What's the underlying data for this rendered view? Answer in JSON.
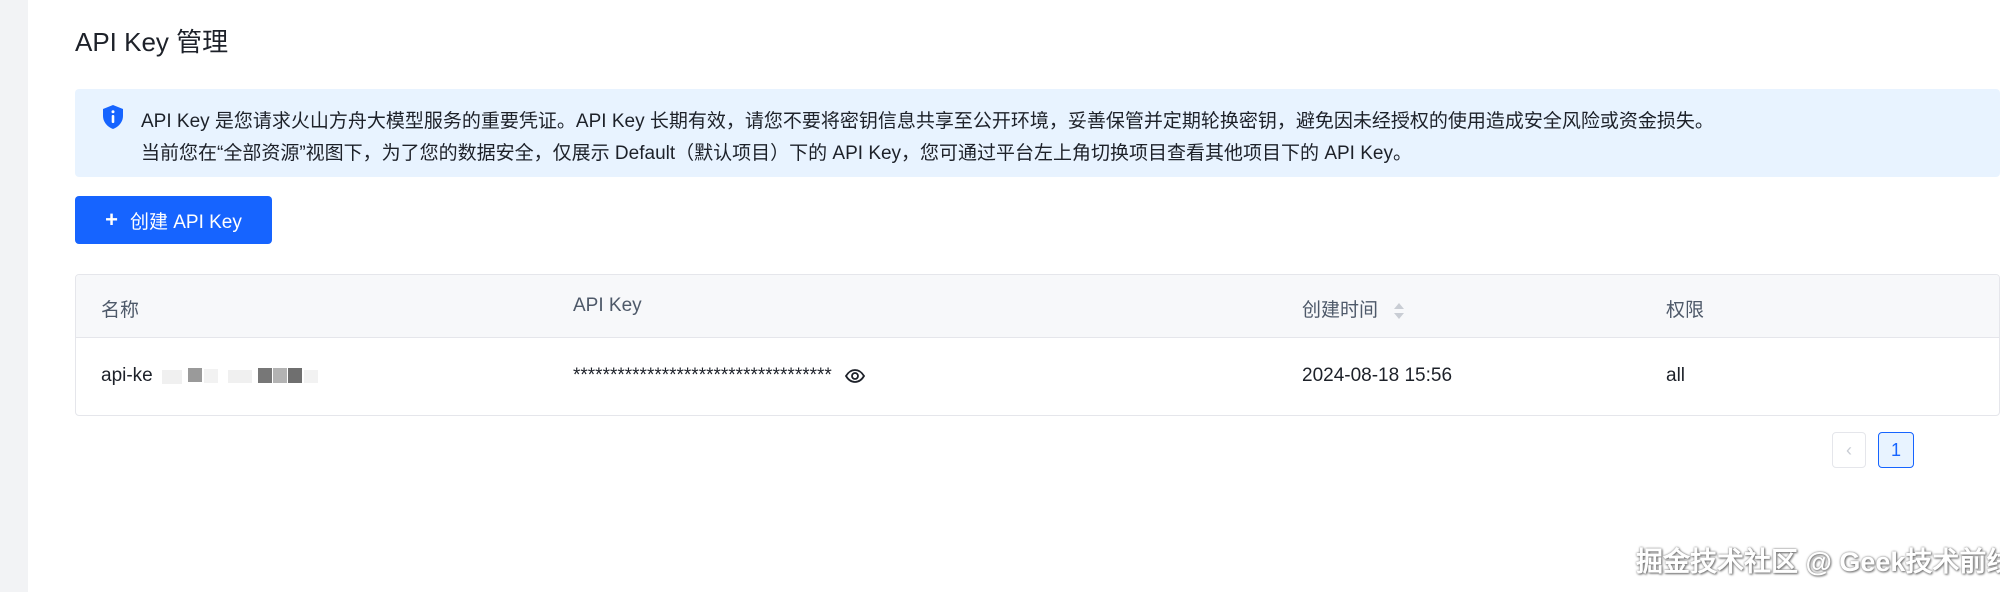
{
  "page": {
    "title": "API Key 管理"
  },
  "notice": {
    "icon": "shield-info-icon",
    "line1": "API Key 是您请求火山方舟大模型服务的重要凭证。API Key 长期有效，请您不要将密钥信息共享至公开环境，妥善保管并定期轮换密钥，避免因未经授权的使用造成安全风险或资金损失。",
    "line2": "当前您在“全部资源”视图下，为了您的数据安全，仅展示 Default（默认项目）下的 API Key，您可通过平台左上角切换项目查看其他项目下的 API Key。"
  },
  "actions": {
    "create_label": "创建 API Key",
    "create_icon": "+"
  },
  "table": {
    "headers": [
      "名称",
      "API Key",
      "创建时间",
      "权限"
    ],
    "rows": [
      {
        "name": "api-ke",
        "key": "***********************************",
        "created": "2024-08-18 15:56",
        "permission": "all"
      }
    ]
  },
  "pagination": {
    "prev": "‹",
    "current": "1"
  },
  "watermark": "掘金技术社区 @ Geek技术前线",
  "colors": {
    "primary": "#1664ff",
    "notice_bg": "#e8f3ff"
  }
}
